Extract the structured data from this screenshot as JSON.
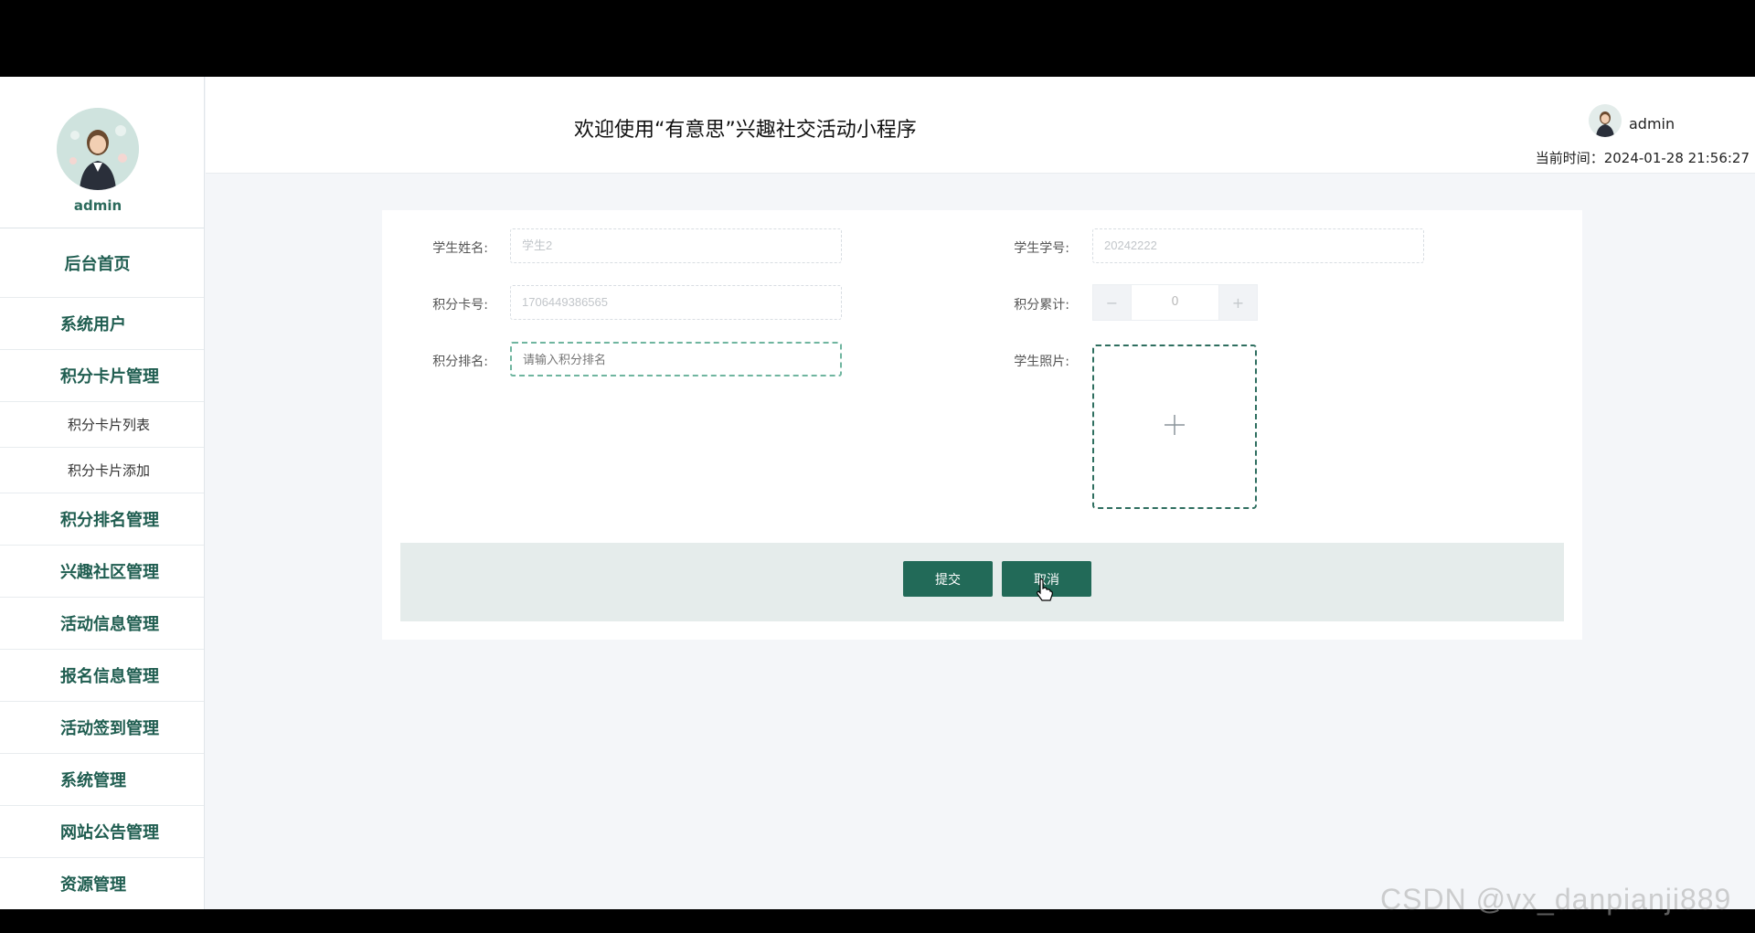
{
  "sidebar": {
    "username": "admin",
    "home": "后台首页",
    "items": [
      {
        "label": "系统用户"
      },
      {
        "label": "积分卡片管理"
      },
      {
        "label": "积分排名管理"
      },
      {
        "label": "兴趣社区管理"
      },
      {
        "label": "活动信息管理"
      },
      {
        "label": "报名信息管理"
      },
      {
        "label": "活动签到管理"
      },
      {
        "label": "系统管理"
      },
      {
        "label": "网站公告管理"
      },
      {
        "label": "资源管理"
      }
    ],
    "subitems": [
      {
        "label": "积分卡片列表"
      },
      {
        "label": "积分卡片添加"
      }
    ]
  },
  "header": {
    "title": "欢迎使用“有意思”兴趣社交活动小程序",
    "user": "admin",
    "time": "当前时间：2024-01-28 21:56:27"
  },
  "form": {
    "student_name_label": "学生姓名:",
    "student_name_value": "学生2",
    "student_id_label": "学生学号:",
    "student_id_value": "20242222",
    "card_no_label": "积分卡号:",
    "card_no_value": "1706449386565",
    "points_total_label": "积分累计:",
    "points_total_value": "0",
    "rank_label": "积分排名:",
    "rank_placeholder": "请输入积分排名",
    "photo_label": "学生照片:",
    "minus": "−",
    "plus": "+",
    "submit": "提交",
    "cancel": "取消"
  },
  "watermark": "CSDN @vx_danpianji889",
  "colors": {
    "accent": "#226a58",
    "nav_text": "#1f5d50",
    "footer_bg": "#e5eceb"
  }
}
